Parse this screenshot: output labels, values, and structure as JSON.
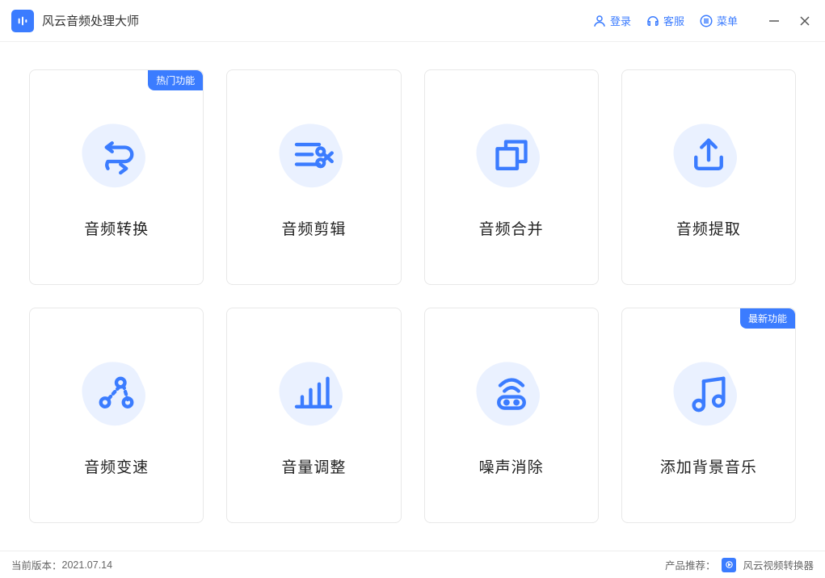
{
  "app": {
    "title": "风云音频处理大师"
  },
  "titlebar": {
    "login": "登录",
    "support": "客服",
    "menu": "菜单"
  },
  "badges": {
    "hot": "热门功能",
    "new": "最新功能"
  },
  "cards": [
    {
      "label": "音频转换"
    },
    {
      "label": "音频剪辑"
    },
    {
      "label": "音频合并"
    },
    {
      "label": "音频提取"
    },
    {
      "label": "音频变速"
    },
    {
      "label": "音量调整"
    },
    {
      "label": "噪声消除"
    },
    {
      "label": "添加背景音乐"
    }
  ],
  "statusbar": {
    "version_label": "当前版本：",
    "version": "2021.07.14",
    "recommend_label": "产品推荐：",
    "recommend_product": "风云视频转换器"
  }
}
